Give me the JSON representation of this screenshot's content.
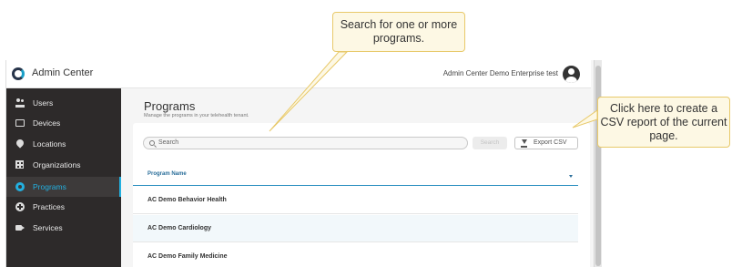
{
  "app": {
    "title": "Admin Center",
    "tenant": "Admin Center Demo Enterprise test"
  },
  "sidebar": {
    "items": [
      {
        "label": "Users",
        "icon": "users-icon",
        "active": false
      },
      {
        "label": "Devices",
        "icon": "devices-icon",
        "active": false
      },
      {
        "label": "Locations",
        "icon": "location-pin-icon",
        "active": false
      },
      {
        "label": "Organizations",
        "icon": "organization-icon",
        "active": false
      },
      {
        "label": "Programs",
        "icon": "programs-icon",
        "active": true
      },
      {
        "label": "Practices",
        "icon": "practices-icon",
        "active": false
      },
      {
        "label": "Services",
        "icon": "video-camera-icon",
        "active": false
      }
    ]
  },
  "main": {
    "title": "Programs",
    "subtitle": "Manage the programs in your telehealth tenant.",
    "search_placeholder": "Search",
    "search_button": "Search",
    "export_button": "Export CSV",
    "column_header": "Program Name",
    "rows": [
      "AC Demo Behavior Health",
      "AC Demo Cardiology",
      "AC Demo Family Medicine"
    ]
  },
  "callouts": {
    "search": "Search for one or more programs.",
    "export": "Click here to create a CSV report of the current page."
  },
  "colors": {
    "accent": "#23b0e0",
    "sidebar_bg": "#2d2a2a",
    "callout_bg": "#fdf8e4",
    "callout_border": "#e8c96a"
  }
}
